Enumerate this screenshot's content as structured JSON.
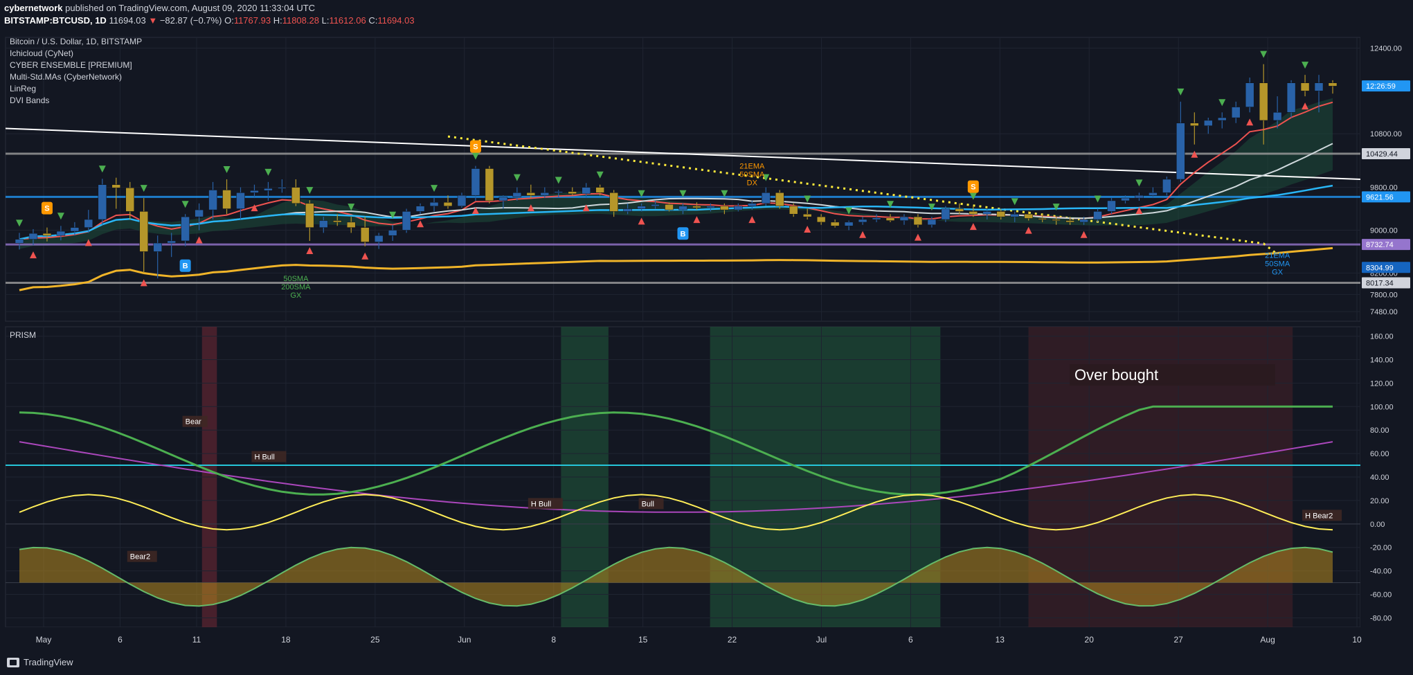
{
  "header": {
    "publisher": "cybernetwork",
    "published_text": "published on TradingView.com, August 09, 2020 11:33:04 UTC",
    "symbol": "BITSTAMP:BTCUSD, 1D",
    "price": "11694.03",
    "change": "−82.87 (−0.7%)",
    "o_label": "O:",
    "o_value": "11767.93",
    "h_label": "H:",
    "h_value": "11808.28",
    "l_label": "L:",
    "l_value": "11612.06",
    "c_label": "C:",
    "c_value": "11694.03"
  },
  "legend": {
    "title": "Bitcoin / U.S. Dollar, 1D, BITSTAMP",
    "indicators": [
      "Ichicloud (CyNet)",
      "CYBER ENSEMBLE [PREMIUM]",
      "Multi-Std.MAs (CyberNetwork)",
      "LinReg",
      "DVI Bands"
    ]
  },
  "prism_label": "PRISM",
  "overbought_label": "Over bought",
  "footer": {
    "brand": "TradingView"
  },
  "colors": {
    "background": "#131722",
    "up": "#2962a8",
    "down": "#b5962a",
    "cloud": "#1e4d3b",
    "ema_red": "#ef5350",
    "sma_white": "#cfd8dc",
    "sma_cyan": "#29b6f6",
    "sma_orange": "#f0b429",
    "trend_yellow": "#ffeb3b"
  },
  "chart_data": [
    {
      "type": "candlestick",
      "title": "Bitcoin / U.S. Dollar, 1D, BITSTAMP",
      "x_tick_labels": [
        "May",
        "6",
        "11",
        "18",
        "25",
        "Jun",
        "8",
        "15",
        "22",
        "Jul",
        "6",
        "13",
        "20",
        "27",
        "Aug",
        "10"
      ],
      "y_tick_labels": [
        "12400.00",
        "10800.00",
        "9800.00",
        "9000.00",
        "8200.00",
        "7800.00",
        "7480.00"
      ],
      "ylim": [
        7300,
        12600
      ],
      "price_labels": [
        {
          "text": "12:26:59",
          "value": 11694,
          "color": "#2196f3"
        },
        {
          "text": "10429.44",
          "value": 10429,
          "color": "#d1d4dc"
        },
        {
          "text": "9621.56",
          "value": 9622,
          "color": "#2196f3"
        },
        {
          "text": "8732.74",
          "value": 8733,
          "color": "#9575cd"
        },
        {
          "text": "8304.99",
          "value": 8305,
          "color": "#1565c0"
        },
        {
          "text": "8017.34",
          "value": 8017,
          "color": "#d1d4dc"
        }
      ],
      "horizontal_levels": [
        {
          "value": 10429,
          "color": "#9e9e9e"
        },
        {
          "value": 9622,
          "color": "#2196f3"
        },
        {
          "value": 8733,
          "color": "#9575cd"
        },
        {
          "value": 8017,
          "color": "#9e9e9e"
        }
      ],
      "candles": [
        {
          "o": 8756,
          "h": 8950,
          "l": 8640,
          "c": 8830
        },
        {
          "o": 8830,
          "h": 9020,
          "l": 8720,
          "c": 8940
        },
        {
          "o": 8940,
          "h": 9050,
          "l": 8790,
          "c": 8900
        },
        {
          "o": 8900,
          "h": 9080,
          "l": 8810,
          "c": 8980
        },
        {
          "o": 8980,
          "h": 9150,
          "l": 8900,
          "c": 9050
        },
        {
          "o": 9050,
          "h": 9380,
          "l": 8950,
          "c": 9200
        },
        {
          "o": 9200,
          "h": 9960,
          "l": 9100,
          "c": 9850
        },
        {
          "o": 9850,
          "h": 9980,
          "l": 9400,
          "c": 9790
        },
        {
          "o": 9790,
          "h": 9900,
          "l": 9200,
          "c": 9350
        },
        {
          "o": 9350,
          "h": 9600,
          "l": 8200,
          "c": 8600
        },
        {
          "o": 8600,
          "h": 8900,
          "l": 8100,
          "c": 8760
        },
        {
          "o": 8760,
          "h": 8950,
          "l": 8500,
          "c": 8800
        },
        {
          "o": 8800,
          "h": 9300,
          "l": 8700,
          "c": 9250
        },
        {
          "o": 9250,
          "h": 9500,
          "l": 9000,
          "c": 9380
        },
        {
          "o": 9380,
          "h": 9900,
          "l": 9200,
          "c": 9750
        },
        {
          "o": 9750,
          "h": 9950,
          "l": 9300,
          "c": 9400
        },
        {
          "o": 9400,
          "h": 9800,
          "l": 9200,
          "c": 9700
        },
        {
          "o": 9700,
          "h": 9850,
          "l": 9600,
          "c": 9740
        },
        {
          "o": 9740,
          "h": 9900,
          "l": 9550,
          "c": 9780
        },
        {
          "o": 9780,
          "h": 9950,
          "l": 9700,
          "c": 9800
        },
        {
          "o": 9800,
          "h": 9950,
          "l": 9450,
          "c": 9500
        },
        {
          "o": 9500,
          "h": 9560,
          "l": 8800,
          "c": 9050
        },
        {
          "o": 9050,
          "h": 9250,
          "l": 8950,
          "c": 9180
        },
        {
          "o": 9180,
          "h": 9300,
          "l": 9080,
          "c": 9150
        },
        {
          "o": 9150,
          "h": 9250,
          "l": 8950,
          "c": 9050
        },
        {
          "o": 9050,
          "h": 9250,
          "l": 8700,
          "c": 8780
        },
        {
          "o": 8780,
          "h": 8950,
          "l": 8650,
          "c": 8900
        },
        {
          "o": 8900,
          "h": 9100,
          "l": 8800,
          "c": 9000
        },
        {
          "o": 9000,
          "h": 9400,
          "l": 8950,
          "c": 9350
        },
        {
          "o": 9350,
          "h": 9500,
          "l": 9300,
          "c": 9450
        },
        {
          "o": 9450,
          "h": 9600,
          "l": 9350,
          "c": 9520
        },
        {
          "o": 9520,
          "h": 9650,
          "l": 9400,
          "c": 9450
        },
        {
          "o": 9450,
          "h": 9700,
          "l": 9420,
          "c": 9650
        },
        {
          "o": 9650,
          "h": 10200,
          "l": 9550,
          "c": 10150
        },
        {
          "o": 10150,
          "h": 10200,
          "l": 9500,
          "c": 9550
        },
        {
          "o": 9550,
          "h": 9650,
          "l": 9400,
          "c": 9620
        },
        {
          "o": 9620,
          "h": 9800,
          "l": 9550,
          "c": 9700
        },
        {
          "o": 9700,
          "h": 9850,
          "l": 9600,
          "c": 9650
        },
        {
          "o": 9650,
          "h": 9800,
          "l": 9600,
          "c": 9700
        },
        {
          "o": 9700,
          "h": 9750,
          "l": 9600,
          "c": 9720
        },
        {
          "o": 9720,
          "h": 9800,
          "l": 9650,
          "c": 9680
        },
        {
          "o": 9680,
          "h": 9880,
          "l": 9600,
          "c": 9800
        },
        {
          "o": 9800,
          "h": 9850,
          "l": 9650,
          "c": 9700
        },
        {
          "o": 9700,
          "h": 9750,
          "l": 9250,
          "c": 9350
        },
        {
          "o": 9350,
          "h": 9500,
          "l": 9300,
          "c": 9400
        },
        {
          "o": 9400,
          "h": 9500,
          "l": 9350,
          "c": 9450
        },
        {
          "o": 9450,
          "h": 9550,
          "l": 9400,
          "c": 9480
        },
        {
          "o": 9480,
          "h": 9520,
          "l": 9350,
          "c": 9380
        },
        {
          "o": 9380,
          "h": 9500,
          "l": 9300,
          "c": 9450
        },
        {
          "o": 9450,
          "h": 9520,
          "l": 9380,
          "c": 9420
        },
        {
          "o": 9420,
          "h": 9500,
          "l": 9350,
          "c": 9450
        },
        {
          "o": 9450,
          "h": 9500,
          "l": 9300,
          "c": 9380
        },
        {
          "o": 9380,
          "h": 9500,
          "l": 9350,
          "c": 9450
        },
        {
          "o": 9450,
          "h": 9550,
          "l": 9380,
          "c": 9500
        },
        {
          "o": 9500,
          "h": 9800,
          "l": 9450,
          "c": 9700
        },
        {
          "o": 9700,
          "h": 9750,
          "l": 9400,
          "c": 9450
        },
        {
          "o": 9450,
          "h": 9500,
          "l": 9250,
          "c": 9300
        },
        {
          "o": 9300,
          "h": 9400,
          "l": 9200,
          "c": 9250
        },
        {
          "o": 9250,
          "h": 9300,
          "l": 9100,
          "c": 9150
        },
        {
          "o": 9150,
          "h": 9200,
          "l": 9050,
          "c": 9080
        },
        {
          "o": 9080,
          "h": 9180,
          "l": 9000,
          "c": 9150
        },
        {
          "o": 9150,
          "h": 9250,
          "l": 9100,
          "c": 9200
        },
        {
          "o": 9200,
          "h": 9300,
          "l": 9150,
          "c": 9230
        },
        {
          "o": 9230,
          "h": 9300,
          "l": 9150,
          "c": 9180
        },
        {
          "o": 9180,
          "h": 9300,
          "l": 9100,
          "c": 9250
        },
        {
          "o": 9250,
          "h": 9300,
          "l": 9050,
          "c": 9100
        },
        {
          "o": 9100,
          "h": 9250,
          "l": 9050,
          "c": 9200
        },
        {
          "o": 9200,
          "h": 9450,
          "l": 9150,
          "c": 9400
        },
        {
          "o": 9400,
          "h": 9500,
          "l": 9300,
          "c": 9350
        },
        {
          "o": 9350,
          "h": 9450,
          "l": 9250,
          "c": 9300
        },
        {
          "o": 9300,
          "h": 9400,
          "l": 9200,
          "c": 9350
        },
        {
          "o": 9350,
          "h": 9400,
          "l": 9200,
          "c": 9250
        },
        {
          "o": 9250,
          "h": 9350,
          "l": 9150,
          "c": 9300
        },
        {
          "o": 9300,
          "h": 9350,
          "l": 9180,
          "c": 9220
        },
        {
          "o": 9220,
          "h": 9300,
          "l": 9150,
          "c": 9200
        },
        {
          "o": 9200,
          "h": 9250,
          "l": 9100,
          "c": 9180
        },
        {
          "o": 9180,
          "h": 9250,
          "l": 9100,
          "c": 9150
        },
        {
          "o": 9150,
          "h": 9250,
          "l": 9100,
          "c": 9200
        },
        {
          "o": 9200,
          "h": 9400,
          "l": 9150,
          "c": 9350
        },
        {
          "o": 9350,
          "h": 9600,
          "l": 9300,
          "c": 9550
        },
        {
          "o": 9550,
          "h": 9650,
          "l": 9500,
          "c": 9600
        },
        {
          "o": 9600,
          "h": 9700,
          "l": 9550,
          "c": 9650
        },
        {
          "o": 9650,
          "h": 9800,
          "l": 9600,
          "c": 9700
        },
        {
          "o": 9700,
          "h": 10000,
          "l": 9650,
          "c": 9950
        },
        {
          "o": 9950,
          "h": 11400,
          "l": 9900,
          "c": 11000
        },
        {
          "o": 11000,
          "h": 11200,
          "l": 10600,
          "c": 10950
        },
        {
          "o": 10950,
          "h": 11100,
          "l": 10800,
          "c": 11050
        },
        {
          "o": 11050,
          "h": 11200,
          "l": 10900,
          "c": 11100
        },
        {
          "o": 11100,
          "h": 11400,
          "l": 11000,
          "c": 11300
        },
        {
          "o": 11300,
          "h": 11850,
          "l": 11200,
          "c": 11750
        },
        {
          "o": 11750,
          "h": 12100,
          "l": 10600,
          "c": 11050
        },
        {
          "o": 11050,
          "h": 11500,
          "l": 10900,
          "c": 11200
        },
        {
          "o": 11200,
          "h": 11800,
          "l": 11100,
          "c": 11750
        },
        {
          "o": 11750,
          "h": 11900,
          "l": 11500,
          "c": 11600
        },
        {
          "o": 11600,
          "h": 11900,
          "l": 11200,
          "c": 11750
        },
        {
          "o": 11750,
          "h": 11800,
          "l": 11550,
          "c": 11690
        }
      ],
      "annotations": [
        {
          "text": "50SMA",
          "color": "#4caf50"
        },
        {
          "text": "200SMA",
          "color": "#4caf50"
        },
        {
          "text": "GX",
          "color": "#4caf50"
        },
        {
          "text": "21EMA",
          "color": "#ff9800"
        },
        {
          "text": "50SMA",
          "color": "#ff9800"
        },
        {
          "text": "DX",
          "color": "#ff9800"
        },
        {
          "text": "21EMA",
          "color": "#2196f3"
        },
        {
          "text": "50SMA",
          "color": "#2196f3"
        },
        {
          "text": "GX",
          "color": "#2196f3"
        }
      ],
      "signal_badges": [
        "S",
        "S",
        "S",
        "B",
        "B"
      ]
    },
    {
      "type": "line",
      "title": "PRISM",
      "y_tick_labels": [
        "160.00",
        "140.00",
        "120.00",
        "100.00",
        "80.00",
        "60.00",
        "40.00",
        "20.00",
        "0.00",
        "-20.00",
        "-40.00",
        "-60.00",
        "-80.00"
      ],
      "ylim": [
        -88,
        168
      ],
      "reference_lines": [
        50,
        0,
        -50
      ],
      "labels": [
        "Bear",
        "H Bull",
        "H Bull",
        "Bull",
        "H Bear2",
        "Bear2"
      ]
    }
  ]
}
